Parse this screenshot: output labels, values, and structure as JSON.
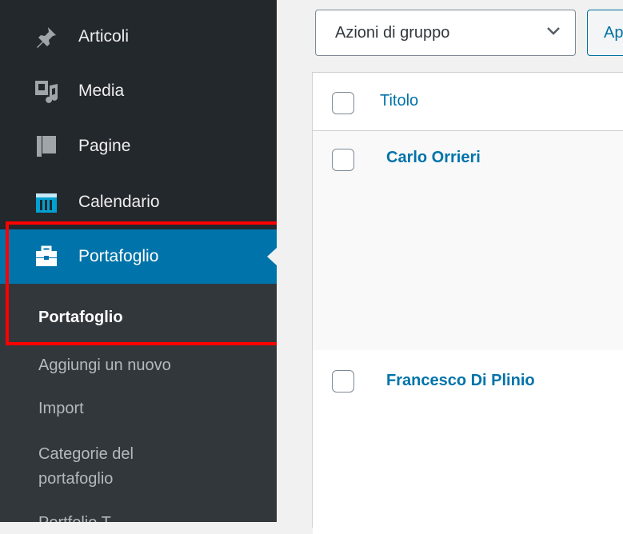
{
  "sidebar": {
    "items": [
      {
        "label": "Articoli",
        "icon": "pin-icon"
      },
      {
        "label": "Media",
        "icon": "media-icon"
      },
      {
        "label": "Pagine",
        "icon": "pages-icon"
      },
      {
        "label": "Calendario",
        "icon": "calendar-icon"
      },
      {
        "label": "Portafoglio",
        "icon": "briefcase-icon",
        "active": true
      }
    ],
    "submenu": [
      {
        "label": "Portafoglio",
        "current": true
      },
      {
        "label": "Aggiungi un nuovo"
      },
      {
        "label": "Import"
      },
      {
        "label": "Categorie del portafoglio"
      },
      {
        "label": "Portfolio T..."
      }
    ]
  },
  "toolbar": {
    "bulk_actions_label": "Azioni di gruppo",
    "apply_label": "Ap"
  },
  "table": {
    "column_title": "Titolo",
    "rows": [
      {
        "title": "Carlo Orrieri"
      },
      {
        "title": "Francesco Di Plinio"
      }
    ]
  },
  "colors": {
    "sidebar_bg": "#23282d",
    "submenu_bg": "#32373c",
    "accent": "#0073aa",
    "highlight": "#ff0000"
  }
}
